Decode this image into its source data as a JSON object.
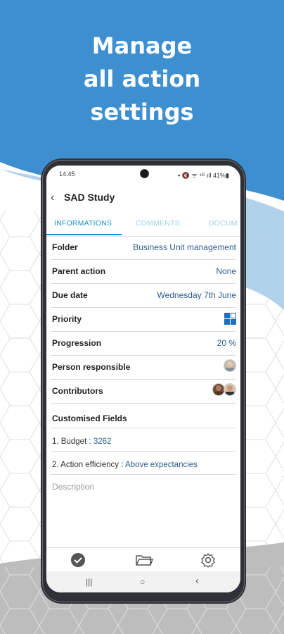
{
  "promo": {
    "headline_lines": [
      "Manage",
      "all action",
      "settings"
    ]
  },
  "status_bar": {
    "time": "14:45",
    "icons_text": "▪ 🔇 ᯤ ⁴ᴳ ıll 41%▮"
  },
  "app": {
    "title": "SAD Study",
    "tabs": [
      {
        "label": "INFORMATIONS",
        "active": true
      },
      {
        "label": "COMMENTS",
        "active": false
      },
      {
        "label": "DOCUM",
        "active": false
      }
    ],
    "rows": [
      {
        "label": "Folder",
        "value": "Business Unit management"
      },
      {
        "label": "Parent action",
        "value": "None"
      },
      {
        "label": "Due date",
        "value": "Wednesday 7th June"
      },
      {
        "label": "Priority",
        "icon": "priority-grid-icon"
      },
      {
        "label": "Progression",
        "value": "20 %"
      },
      {
        "label": "Person responsible",
        "icon": "avatar"
      },
      {
        "label": "Contributors",
        "icon": "avatar-group"
      }
    ],
    "custom_fields": {
      "title": "Customised Fields",
      "fields": [
        {
          "label": "1. Budget : ",
          "value": "3262"
        },
        {
          "label": "2. Action efficiency : ",
          "value": "Above expectancies"
        }
      ]
    },
    "description_placeholder": "Description"
  },
  "bottom_nav": {
    "items": [
      "check-circle-icon",
      "folder-icon",
      "gear-icon"
    ]
  },
  "system_nav": {
    "recents": "|||",
    "home": "○",
    "back": "‹"
  },
  "colors": {
    "brand_blue": "#3d8fd0",
    "tab_active": "#1a8fcb",
    "value_text": "#2d5e8e"
  }
}
